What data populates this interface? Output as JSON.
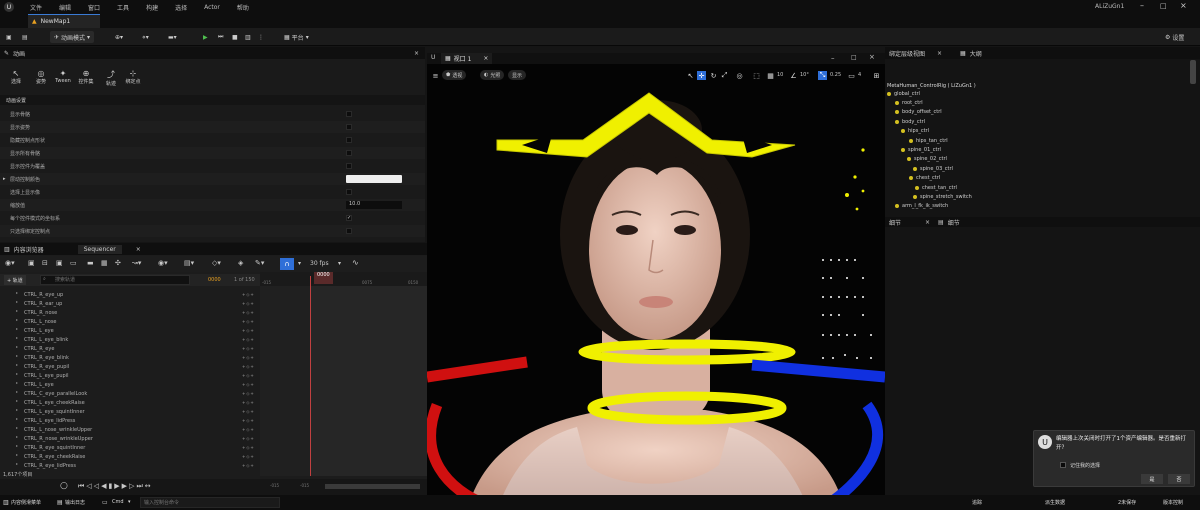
{
  "menu": {
    "logo": "U",
    "items": [
      "文件",
      "编辑",
      "窗口",
      "工具",
      "构建",
      "选择",
      "Actor",
      "帮助"
    ],
    "user": "ALiZuGn1"
  },
  "doc_tab": {
    "label": "NewMap1"
  },
  "toolbar": {
    "mode": "动画模式",
    "platform": "平台",
    "settings": "设置"
  },
  "animation_panel": {
    "title": "动画",
    "tools": [
      "选择",
      "姿势",
      "Tween",
      "控件集",
      "轨迹",
      "绑定点"
    ],
    "section": "动画设置",
    "rows": [
      {
        "label": "显示骨骼",
        "type": "check"
      },
      {
        "label": "显示姿势",
        "type": "check"
      },
      {
        "label": "隐藏控制点形状",
        "type": "check"
      },
      {
        "label": "显示所有骨骼",
        "type": "check"
      },
      {
        "label": "显示控件为覆盖",
        "type": "check"
      },
      {
        "label": "层动控制颜色",
        "type": "swatch"
      },
      {
        "label": "选择上显示像",
        "type": "check"
      },
      {
        "label": "缩放值",
        "type": "value",
        "value": "10.0"
      },
      {
        "label": "每个控件模式的坐标系",
        "type": "checked"
      },
      {
        "label": "只选择绑定控制点",
        "type": "check"
      }
    ]
  },
  "content_tabs": {
    "browser": "内容浏览器",
    "sequencer": "Sequencer"
  },
  "sequencer": {
    "add_track": "+ 轨道",
    "search_placeholder": "搜索轨道",
    "frame": "0000",
    "frame_of": "1 of 150",
    "fps": "30 fps",
    "playhead": "0000",
    "tick_a": "-015",
    "tick_b": "0075",
    "tick_c": "0150",
    "bottom_a": "-015",
    "bottom_b": "-015",
    "item_count": "1,617个项目",
    "tracks": [
      "CTRL_R_eye_up",
      "CTRL_R_ear_up",
      "CTRL_R_nose",
      "CTRL_L_nose",
      "CTRL_L_eye",
      "CTRL_L_eye_blink",
      "CTRL_R_eye",
      "CTRL_R_eye_blink",
      "CTRL_R_eye_pupil",
      "CTRL_L_eye_pupil",
      "CTRL_L_eye",
      "CTRL_C_eye_parallelLook",
      "CTRL_L_eye_cheekRaise",
      "CTRL_L_eye_squintInner",
      "CTRL_L_eye_lidPress",
      "CTRL_L_nose_wrinkleUpper",
      "CTRL_R_nose_wrinkleUpper",
      "CTRL_R_eye_squintInner",
      "CTRL_R_eye_cheekRaise",
      "CTRL_R_eye_lidPress"
    ]
  },
  "viewport": {
    "tab": "视口 1",
    "perspective": "透视",
    "lit": "光照",
    "show": "显示",
    "grid": "10",
    "angle": "10°",
    "scale": "0.25",
    "cam": "4"
  },
  "outliner": {
    "tab1": "绑定层级视图",
    "tab2": "大纲",
    "root": "MetaHuman_ControlRig ( LiZuGn1 )",
    "items": [
      "global_ctrl",
      "root_ctrl",
      "body_offset_ctrl",
      "body_ctrl",
      "hips_ctrl",
      "hips_tan_ctrl",
      "spine_01_ctrl",
      "spine_02_ctrl",
      "spine_03_ctrl",
      "chest_ctrl",
      "chest_tan_ctrl",
      "spine_stretch_switch",
      "arm_l_fk_ik_switch"
    ],
    "details_tab1": "细节",
    "details_tab2": "细节"
  },
  "notification": {
    "text": "编辑器上次关闭时打开了1个资产编辑器。是否重新打开？",
    "remember": "记住我的选择",
    "yes": "是",
    "no": "否"
  },
  "statusbar": {
    "content_drawer": "内容侧滑菜单",
    "output_log": "输出日志",
    "cmd": "Cmd",
    "console_placeholder": "输入控制台命令",
    "trace": "追踪",
    "derived": "派生数据",
    "unsaved": "2未保存",
    "source_control": "版本控制"
  },
  "colors": {
    "accent": "#3a7bd5",
    "yellow": "#f0f000",
    "red": "#d01010",
    "blue": "#1030e0"
  }
}
